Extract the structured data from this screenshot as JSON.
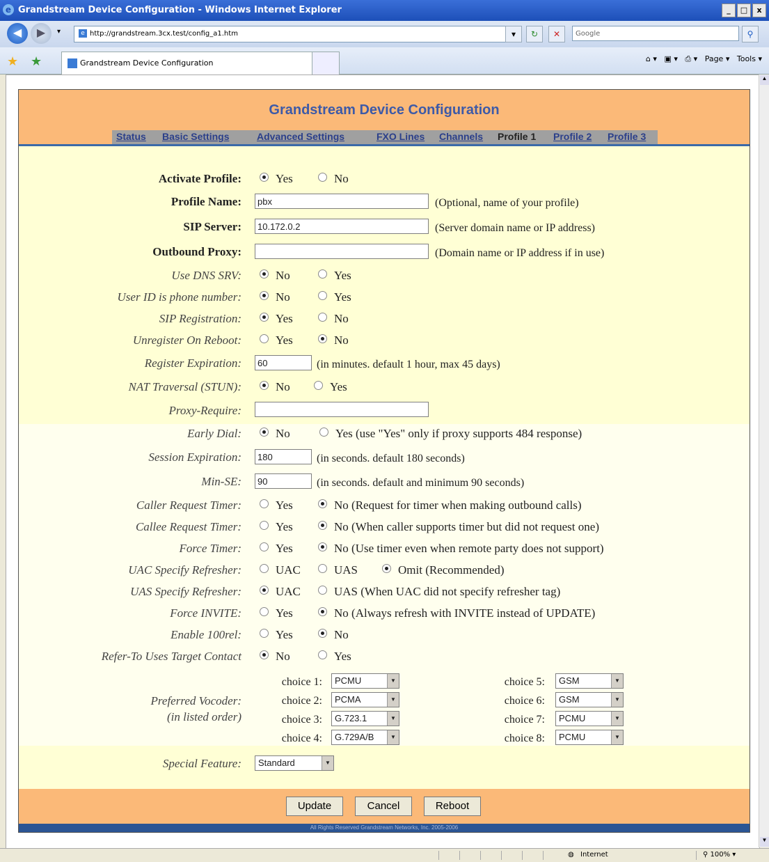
{
  "window": {
    "title": "Grandstream Device Configuration - Windows Internet Explorer",
    "min": "_",
    "max": "□",
    "close": "x"
  },
  "browser": {
    "url": "http://grandstream.3cx.test/config_a1.htm",
    "search_placeholder": "Google",
    "tab_title": "Grandstream Device Configuration",
    "page_menu": "Page",
    "tools_menu": "Tools"
  },
  "status": {
    "zone": "Internet",
    "zoom": "100%"
  },
  "page": {
    "title": "Grandstream Device Configuration",
    "nav": [
      "Status",
      "Basic Settings",
      "Advanced Settings",
      "FXO Lines",
      "Channels",
      "Profile 1",
      "Profile 2",
      "Profile 3"
    ],
    "nav_active": "Profile 1",
    "copyright": "All Rights Reserved Grandstream Networks, Inc. 2005-2006"
  },
  "form": {
    "activate_profile": {
      "label": "Activate Profile:",
      "opt1": "Yes",
      "opt2": "No",
      "selected": "Yes"
    },
    "profile_name": {
      "label": "Profile Name:",
      "value": "pbx",
      "hint": "(Optional, name of your profile)"
    },
    "sip_server": {
      "label": "SIP Server:",
      "value": "10.172.0.2",
      "hint": "(Server domain name or IP address)"
    },
    "outbound_proxy": {
      "label": "Outbound Proxy:",
      "value": "",
      "hint": "(Domain name or IP address if in use)"
    },
    "use_dns_srv": {
      "label": "Use DNS SRV:",
      "opt1": "No",
      "opt2": "Yes",
      "selected": "No"
    },
    "user_id_phone": {
      "label": "User ID is phone number:",
      "opt1": "No",
      "opt2": "Yes",
      "selected": "No"
    },
    "sip_registration": {
      "label": "SIP Registration:",
      "opt1": "Yes",
      "opt2": "No",
      "selected": "Yes"
    },
    "unregister_reboot": {
      "label": "Unregister On Reboot:",
      "opt1": "Yes",
      "opt2": "No",
      "selected": "No"
    },
    "register_expiration": {
      "label": "Register Expiration:",
      "value": "60",
      "hint": "(in minutes. default 1 hour, max 45 days)"
    },
    "nat_traversal": {
      "label": "NAT Traversal (STUN):",
      "opt1": "No",
      "opt2": "Yes",
      "selected": "No"
    },
    "proxy_require": {
      "label": "Proxy-Require:",
      "value": ""
    },
    "early_dial": {
      "label": "Early Dial:",
      "opt1": "No",
      "opt2": "Yes (use \"Yes\" only if proxy supports 484 response)",
      "selected": "No"
    },
    "session_expiration": {
      "label": "Session Expiration:",
      "value": "180",
      "hint": "(in seconds. default 180 seconds)"
    },
    "min_se": {
      "label": "Min-SE:",
      "value": "90",
      "hint": "(in seconds. default and minimum 90 seconds)"
    },
    "caller_request_timer": {
      "label": "Caller Request Timer:",
      "opt1": "Yes",
      "opt2": "No (Request for timer when making outbound calls)",
      "selected": "No"
    },
    "callee_request_timer": {
      "label": "Callee Request Timer:",
      "opt1": "Yes",
      "opt2": "No (When caller supports timer but did not request one)",
      "selected": "No"
    },
    "force_timer": {
      "label": "Force Timer:",
      "opt1": "Yes",
      "opt2": "No (Use timer even when remote party does not support)",
      "selected": "No"
    },
    "uac_specify_refresher": {
      "label": "UAC Specify Refresher:",
      "opt1": "UAC",
      "opt2": "UAS",
      "opt3": "Omit (Recommended)",
      "selected": "Omit"
    },
    "uas_specify_refresher": {
      "label": "UAS Specify Refresher:",
      "opt1": "UAC",
      "opt2": "UAS (When UAC did not specify refresher tag)",
      "selected": "UAC"
    },
    "force_invite": {
      "label": "Force INVITE:",
      "opt1": "Yes",
      "opt2": "No (Always refresh with INVITE instead of UPDATE)",
      "selected": "No"
    },
    "enable_100rel": {
      "label": "Enable 100rel:",
      "opt1": "Yes",
      "opt2": "No",
      "selected": "No"
    },
    "refer_to": {
      "label": "Refer-To Uses Target Contact",
      "opt1": "No",
      "opt2": "Yes",
      "selected": "No"
    },
    "vocoder": {
      "label1": "Preferred Vocoder:",
      "label2": "(in listed order)",
      "choices": [
        {
          "label": "choice 1:",
          "value": "PCMU"
        },
        {
          "label": "choice 2:",
          "value": "PCMA"
        },
        {
          "label": "choice 3:",
          "value": "G.723.1"
        },
        {
          "label": "choice 4:",
          "value": "G.729A/B"
        },
        {
          "label": "choice 5:",
          "value": "GSM"
        },
        {
          "label": "choice 6:",
          "value": "GSM"
        },
        {
          "label": "choice 7:",
          "value": "PCMU"
        },
        {
          "label": "choice 8:",
          "value": "PCMU"
        }
      ]
    },
    "special_feature": {
      "label": "Special Feature:",
      "value": "Standard"
    }
  },
  "buttons": {
    "update": "Update",
    "cancel": "Cancel",
    "reboot": "Reboot"
  }
}
